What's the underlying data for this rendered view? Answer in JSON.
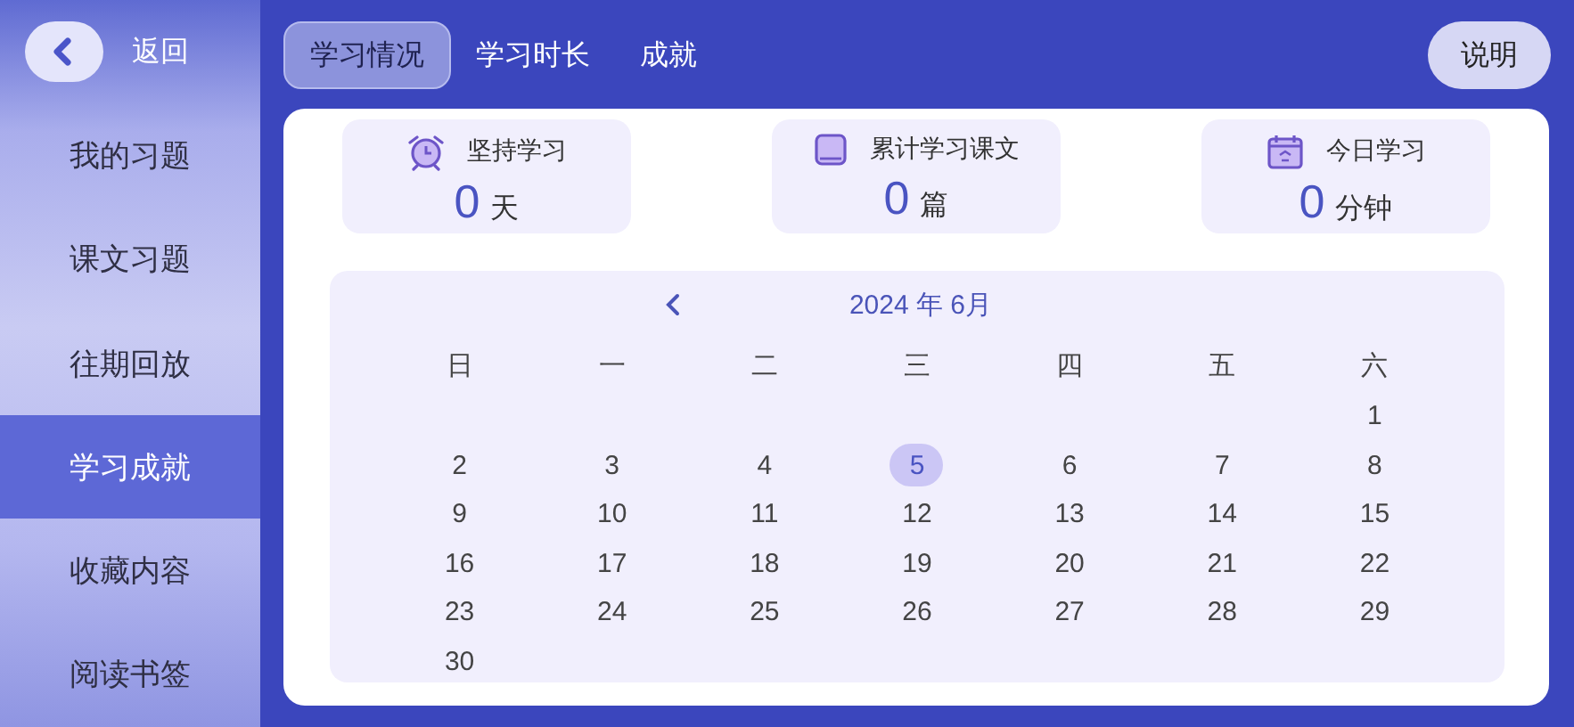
{
  "sidebar": {
    "back_label": "返回",
    "items": [
      {
        "label": "我的习题",
        "selected": false
      },
      {
        "label": "课文习题",
        "selected": false
      },
      {
        "label": "往期回放",
        "selected": false
      },
      {
        "label": "学习成就",
        "selected": true
      },
      {
        "label": "收藏内容",
        "selected": false
      },
      {
        "label": "阅读书签",
        "selected": false
      }
    ]
  },
  "tabs": [
    {
      "label": "学习情况",
      "selected": true
    },
    {
      "label": "学习时长",
      "selected": false
    },
    {
      "label": "成就",
      "selected": false
    }
  ],
  "help_button": "说明",
  "stats": [
    {
      "kind": "clock",
      "label": "坚持学习",
      "value": "0",
      "unit": "天"
    },
    {
      "kind": "book",
      "label": "累计学习课文",
      "value": "0",
      "unit": "篇"
    },
    {
      "kind": "calendar",
      "label": "今日学习",
      "value": "0",
      "unit": "分钟"
    }
  ],
  "calendar": {
    "title": "2024 年 6月",
    "weekdays": [
      "日",
      "一",
      "二",
      "三",
      "四",
      "五",
      "六"
    ],
    "weeks": [
      [
        {
          "label": "1",
          "selected": false
        }
      ],
      [
        {
          "label": "2",
          "selected": false
        },
        {
          "label": "3",
          "selected": false
        },
        {
          "label": "4",
          "selected": false
        },
        {
          "label": "5",
          "selected": true
        },
        {
          "label": "6",
          "selected": false
        },
        {
          "label": "7",
          "selected": false
        },
        {
          "label": "8",
          "selected": false
        }
      ],
      [
        {
          "label": "9",
          "selected": false
        },
        {
          "label": "10",
          "selected": false
        },
        {
          "label": "11",
          "selected": false
        },
        {
          "label": "12",
          "selected": false
        },
        {
          "label": "13",
          "selected": false
        },
        {
          "label": "14",
          "selected": false
        },
        {
          "label": "15",
          "selected": false
        }
      ],
      [
        {
          "label": "16",
          "selected": false
        },
        {
          "label": "17",
          "selected": false
        },
        {
          "label": "18",
          "selected": false
        },
        {
          "label": "19",
          "selected": false
        },
        {
          "label": "20",
          "selected": false
        },
        {
          "label": "21",
          "selected": false
        },
        {
          "label": "22",
          "selected": false
        }
      ],
      [
        {
          "label": "23",
          "selected": false
        },
        {
          "label": "24",
          "selected": false
        },
        {
          "label": "25",
          "selected": false
        },
        {
          "label": "26",
          "selected": false
        },
        {
          "label": "27",
          "selected": false
        },
        {
          "label": "28",
          "selected": false
        },
        {
          "label": "29",
          "selected": false
        }
      ],
      [
        {
          "label": "30",
          "selected": false
        }
      ]
    ]
  }
}
